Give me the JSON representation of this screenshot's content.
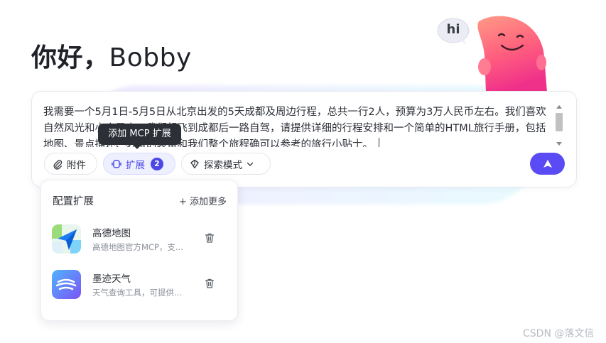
{
  "greeting": {
    "hello": "你好，",
    "name": "Bobby"
  },
  "mascot": {
    "speech": "hi"
  },
  "prompt": {
    "text": "我需要一个5月1日-5月5日从北京出发的5天成都及周边行程，总共一行2人，预算为3万人民币左右。我们喜欢自然风光和小众景点。我们想飞到成都后一路自驾，请提供详细的行程安排和一个简单的HTML旅行手册，包括地图、景点描述、必备的装备和我们整个旅程确可以参考的旅行小贴士。"
  },
  "tooltip": {
    "text": "添加 MCP 扩展"
  },
  "toolbar": {
    "attach_label": "附件",
    "ext_label": "扩展",
    "ext_count": "2",
    "search_mode_label": "探索模式"
  },
  "panel": {
    "title": "配置扩展",
    "add_more": "+ 添加更多",
    "items": [
      {
        "title": "高德地图",
        "desc": "高德地图官方MCP，支..."
      },
      {
        "title": "墨迹天气",
        "desc": "天气查询工具，可提供..."
      }
    ]
  },
  "watermark": "CSDN @落文信",
  "colors": {
    "accent": "#5b4bf5",
    "tooltip_bg": "#2c2f36"
  }
}
